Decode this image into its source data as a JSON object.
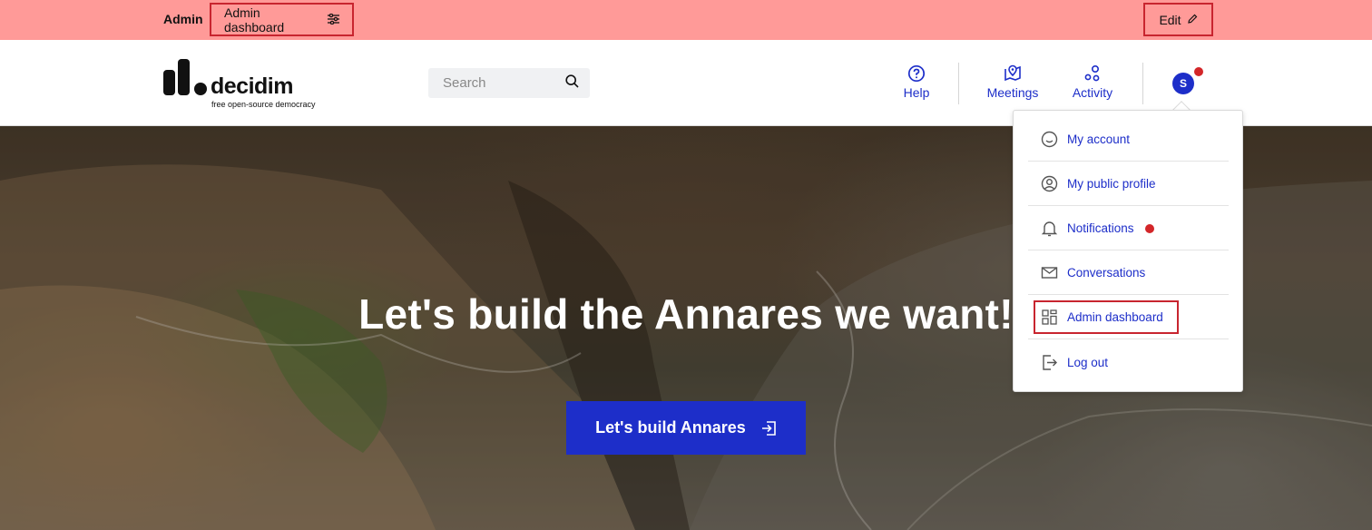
{
  "admin_bar": {
    "label": "Admin",
    "dashboard_label": "Admin dashboard",
    "edit_label": "Edit",
    "background": "#ff9a98",
    "highlight_color": "#c8252f"
  },
  "header": {
    "logo": {
      "wordmark": "decidim",
      "tagline": "free open-source democracy"
    },
    "search": {
      "placeholder": "Search",
      "value": ""
    },
    "nav": {
      "help": "Help",
      "meetings": "Meetings",
      "activity": "Activity"
    },
    "avatar_initial": "S",
    "accent": "#1d2ec9",
    "notification_color": "#d32629"
  },
  "hero": {
    "title": "Let's build the Annares we want!",
    "cta_label": "Let's build Annares"
  },
  "user_menu": {
    "items": [
      {
        "label": "My account",
        "icon": "smile-icon"
      },
      {
        "label": "My public profile",
        "icon": "user-circle-icon"
      },
      {
        "label": "Notifications",
        "icon": "bell-icon",
        "has_dot": true
      },
      {
        "label": "Conversations",
        "icon": "mail-icon"
      },
      {
        "label": "Admin dashboard",
        "icon": "dashboard-icon",
        "highlighted": true
      },
      {
        "label": "Log out",
        "icon": "logout-icon"
      }
    ]
  }
}
